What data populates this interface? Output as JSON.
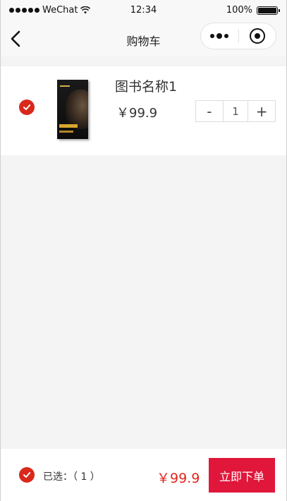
{
  "status_bar": {
    "carrier": "WeChat",
    "time": "12:34",
    "battery": "100%"
  },
  "nav": {
    "title": "购物车"
  },
  "cart": {
    "items": [
      {
        "name": "图书名称1",
        "price": "￥99.9",
        "quantity": "1",
        "selected": true,
        "minus_label": "-",
        "plus_label": "+"
      }
    ]
  },
  "footer": {
    "selected_text": "已选：（ 1 ）",
    "total": "￥99.9",
    "submit_label": "立即下单"
  },
  "colors": {
    "accent": "#d9281c",
    "price": "#e1251b",
    "submit_bg": "#e0163b"
  },
  "icons": {
    "back": "chevron-left-icon",
    "more": "more-dots-icon",
    "close": "target-circle-icon",
    "check": "checkmark-icon"
  }
}
